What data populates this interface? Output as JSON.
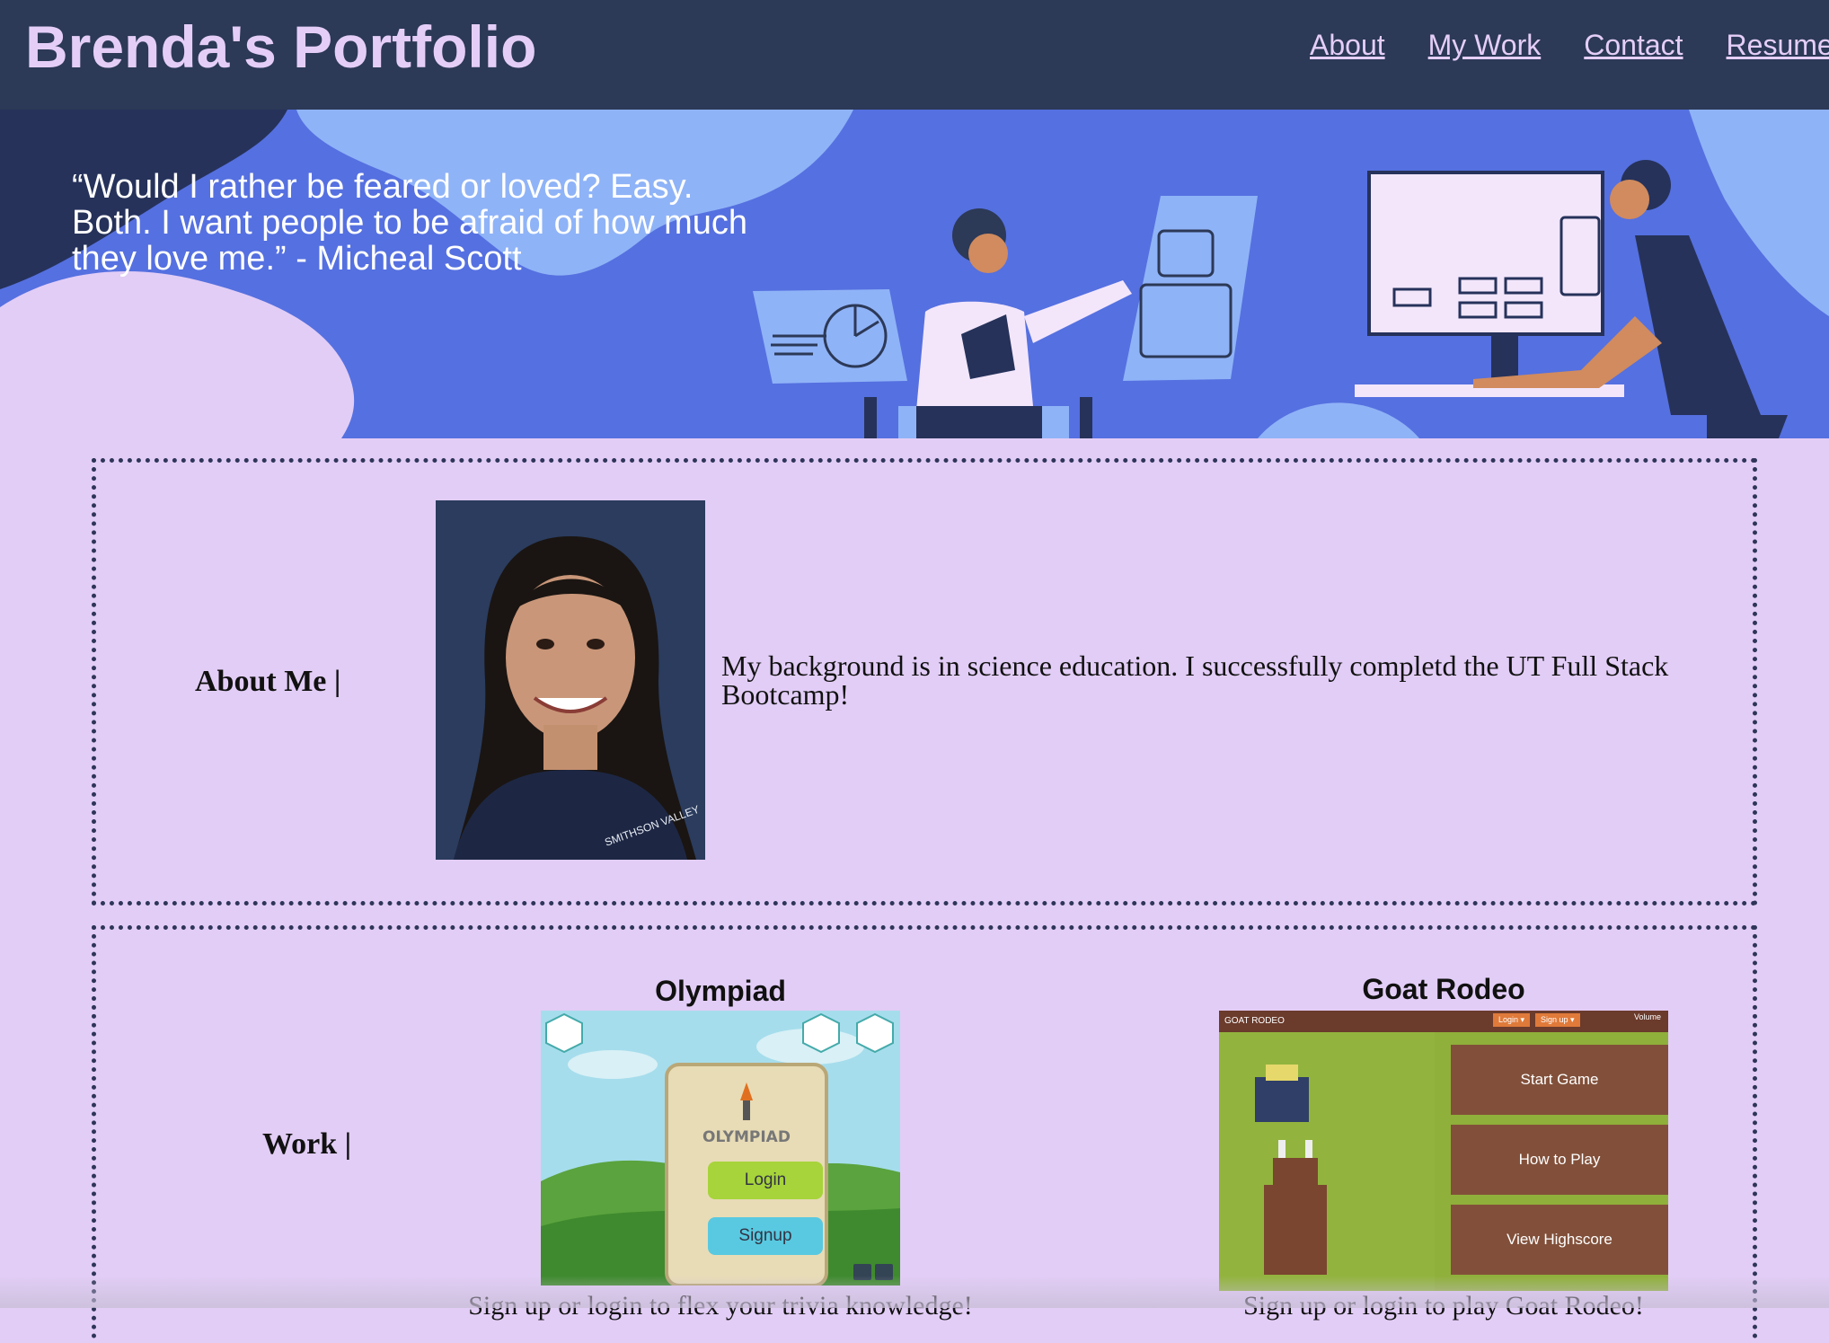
{
  "header": {
    "title": "Brenda's Portfolio",
    "nav": [
      "About",
      "My Work",
      "Contact",
      "Resume"
    ]
  },
  "hero": {
    "quote": "“Would I rather be feared or loved? Easy. Both. I want people to be afraid of how much they love me.” - Micheal Scott"
  },
  "about": {
    "label": "About Me |",
    "bio": "My background is in science education. I successfully completd the UT Full Stack Bootcamp!",
    "photo_shirt_text": "SMITHSON VALLEY"
  },
  "work": {
    "label": "Work |",
    "projects": [
      {
        "title": "Olympiad",
        "logo": "OLYMPIAD",
        "login": "Login",
        "signup": "Signup",
        "description": "Sign up or login to flex your trivia knowledge!"
      },
      {
        "title": "Goat Rodeo",
        "bar_title": "GOAT RODEO",
        "bar_login": "Login ▾",
        "bar_signup": "Sign up ▾",
        "volume": "Volume",
        "start": "Start Game",
        "howto": "How to Play",
        "highscore": "View Highscore",
        "description": "Sign up or login to play Goat Rodeo!"
      }
    ]
  },
  "colors": {
    "header_bg": "#2c3957",
    "header_text": "#e4cef8",
    "page_bg": "#e2cdf6",
    "hero_bg": "#5570e0",
    "border": "#2e3558"
  }
}
